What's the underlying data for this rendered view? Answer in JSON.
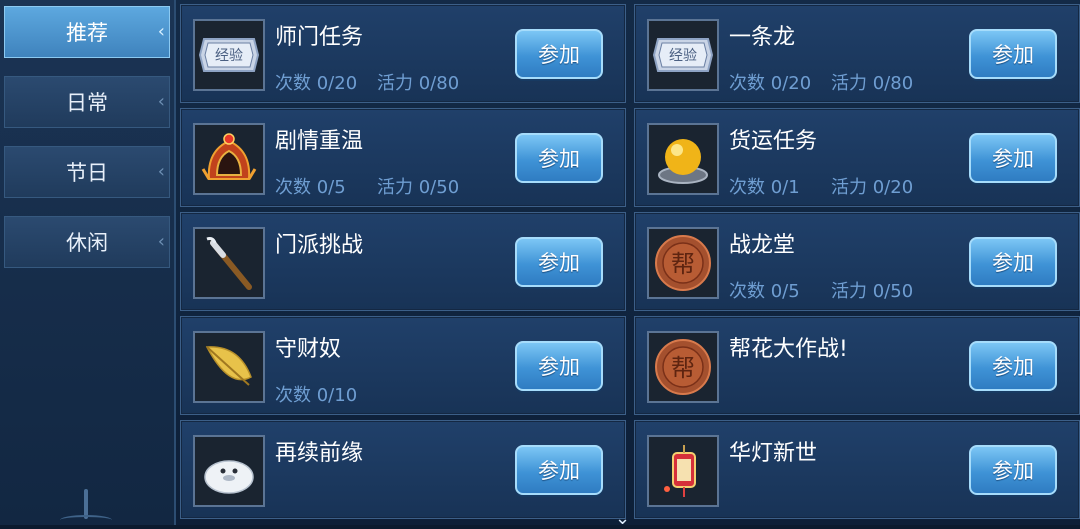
{
  "tabs": [
    {
      "label": "推荐",
      "active": true
    },
    {
      "label": "日常",
      "active": false
    },
    {
      "label": "节日",
      "active": false
    },
    {
      "label": "休闲",
      "active": false
    }
  ],
  "join_label": "参加",
  "activities": [
    {
      "title": "师门任务",
      "count": "次数 0/20",
      "vitality": "活力 0/80",
      "icon": "exp-ticket-icon"
    },
    {
      "title": "一条龙",
      "count": "次数 0/20",
      "vitality": "活力 0/80",
      "icon": "exp-ticket-icon"
    },
    {
      "title": "剧情重温",
      "count": "次数 0/5",
      "vitality": "活力 0/50",
      "icon": "helmet-icon"
    },
    {
      "title": "货运任务",
      "count": "次数 0/1",
      "vitality": "活力 0/20",
      "icon": "gold-orb-icon"
    },
    {
      "title": "门派挑战",
      "count": "",
      "vitality": "",
      "icon": "brush-icon"
    },
    {
      "title": "战龙堂",
      "count": "次数 0/5",
      "vitality": "活力 0/50",
      "icon": "guild-coin-icon"
    },
    {
      "title": "守财奴",
      "count": "次数 0/10",
      "vitality": "",
      "icon": "golden-leaf-icon"
    },
    {
      "title": "帮花大作战!",
      "count": "",
      "vitality": "",
      "icon": "guild-coin-icon"
    },
    {
      "title": "再续前缘",
      "count": "",
      "vitality": "",
      "icon": "seal-pet-icon"
    },
    {
      "title": "华灯新世",
      "count": "",
      "vitality": "",
      "icon": "lantern-icon"
    }
  ],
  "icon_text": {
    "exp": "经验",
    "guild": "帮"
  },
  "scroll_hint": "⌄"
}
